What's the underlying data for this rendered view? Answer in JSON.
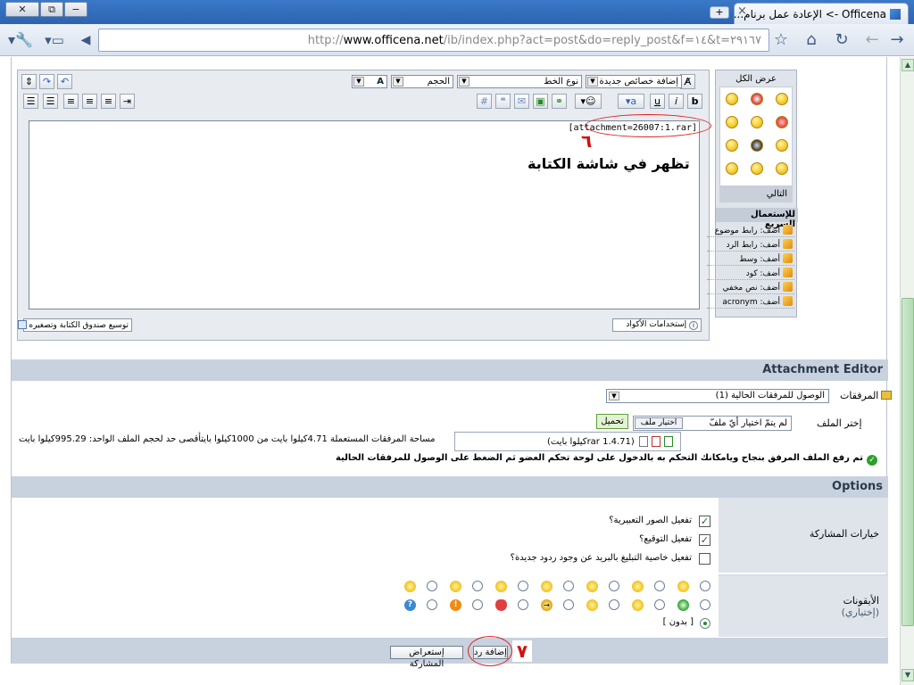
{
  "browser": {
    "tab_title": "Officena -> الإعادة عمل برنام...",
    "url_prefix": "http://",
    "url_domain": "www.officena.net",
    "url_path": "/ib/index.php?act=post&do=reply_post&f=١٤&t=٢٩١٦٧",
    "new_tab": "+",
    "close": "×"
  },
  "editor": {
    "font_select": "نوع الخط",
    "size_select": "الحجم",
    "props_select": "إضافة خصائص جديدة",
    "attachment_tag": "[attachment=26007:1.rar]",
    "note_text": "تظهر في شاشة الكتابة",
    "annotation_number": "٦",
    "expand_label": "توسيع صندوق الكتابة وتصغيره",
    "codes_label": "إستخدامات الأكواد",
    "bold": "b",
    "italic": "i",
    "underline": "u"
  },
  "side": {
    "show_all": "عرض الكل",
    "next": "التالي",
    "quick_title": "للإستعمال السريع",
    "quick_items": [
      "أضف: رابط موضوع",
      "أضف: رابط الرد",
      "أضف: وسط",
      "أضف: كود",
      "أضف: نص مخفي",
      "أضف: acronym"
    ]
  },
  "attachment_editor": {
    "title": "Attachment Editor",
    "attachments_label": "المرفقات",
    "attachments_select": "الوصول للمرفقات الحالية (1)",
    "choose_file_label": "إختر الملف",
    "choose_file_button": "اختيار ملف",
    "no_file_text": "لم يتمّ اختيار أيّ ملفّ",
    "upload_button": "تحميل",
    "file_entry": "(rar 1.4.71كيلوا بايت)",
    "usage_text": "مساحة المرفقات المستعملة 4.71كيلوا بايت من 1000كيلوا بايتأقصى حد لحجم الملف الواحد: 995.29كيلوا بايت",
    "success_text": "تم رفع الملف المرفق بنجاح ويامكانك التحكم به بالدخول على لوحة تحكم العضو ثم الضغط على الوصول للمرفقات الحالية"
  },
  "options": {
    "title": "Options",
    "post_options_label": "خيارات المشاركة",
    "opt_emoticons": "تفعيل الصور التعبيرية؟",
    "opt_signature": "تفعيل التوقيع؟",
    "opt_notify": "تفعيل خاصية التبليغ بالبريد عن وجود ردود جديدة؟",
    "opt_emoticons_checked": true,
    "opt_signature_checked": true,
    "opt_notify_checked": false,
    "icons_label": "الأيقونات",
    "icons_optional": "(إختياري)",
    "none_label": "[ بدون ]"
  },
  "actions": {
    "add_reply": "إضافة رد",
    "preview": "إستعراض المشاركة",
    "annotation_number": "٧"
  },
  "colors": {
    "accent_red": "#e02020",
    "bar_bg": "#c8d2de",
    "panel_bg": "#dfe4ea"
  }
}
